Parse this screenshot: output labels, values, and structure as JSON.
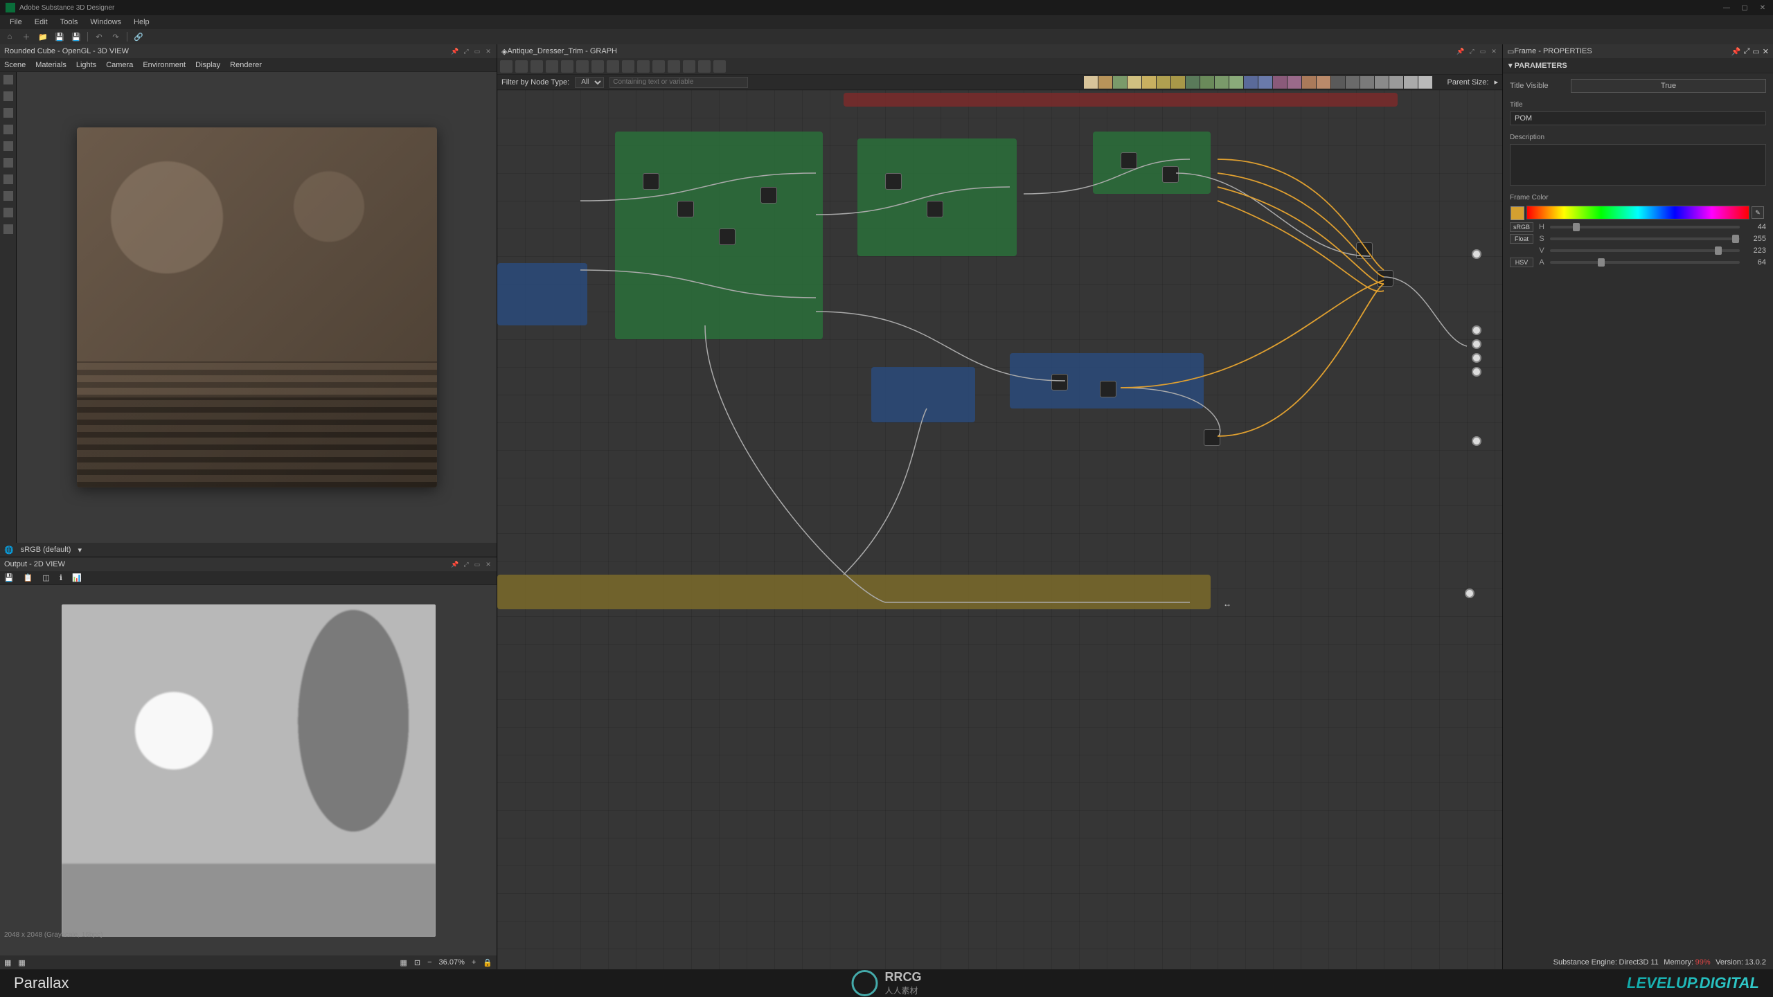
{
  "app": {
    "title": "Adobe Substance 3D Designer"
  },
  "menu": [
    "File",
    "Edit",
    "Tools",
    "Windows",
    "Help"
  ],
  "view3d": {
    "title": "Rounded Cube - OpenGL - 3D VIEW",
    "tabs": [
      "Scene",
      "Materials",
      "Lights",
      "Camera",
      "Environment",
      "Display",
      "Renderer"
    ]
  },
  "colorspace": {
    "label": "sRGB (default)"
  },
  "view2d": {
    "title": "Output - 2D VIEW",
    "status": "2048 x 2048 (Grayscale, 16bpc)",
    "zoom": "36.07%"
  },
  "graph": {
    "title": "Antique_Dresser_Trim - GRAPH",
    "filter_label": "Filter by Node Type:",
    "filter_value": "All",
    "contain_placeholder": "Containing text or variable",
    "parent_label": "Parent Size:"
  },
  "props": {
    "title": "Frame - PROPERTIES",
    "section": "PARAMETERS",
    "title_visible_label": "Title Visible",
    "title_visible_value": "True",
    "title_label": "Title",
    "title_value": "POM",
    "desc_label": "Description",
    "framecolor_label": "Frame Color",
    "hsv": {
      "srgb": "sRGB",
      "float": "Float",
      "hsv": "HSV",
      "H": 44,
      "S": 255,
      "V": 223,
      "A": 64
    }
  },
  "engine": {
    "label_engine": "Substance Engine:",
    "engine": "Direct3D 11",
    "label_mem": "Memory:",
    "mem": "99%",
    "label_ver": "Version:",
    "ver": "13.0.2"
  },
  "footer": {
    "caption": "Parallax",
    "brand_cn": "人人素材",
    "brand_en": "RRCG",
    "levelup": "LEVELUP.DIGITAL"
  },
  "node_palette": [
    "#d8c49a",
    "#b8945a",
    "#7a9a6a",
    "#d0c080",
    "#c8b060",
    "#b0a050",
    "#a89848",
    "#5a7a5a",
    "#6a8a5a",
    "#7a9a6a",
    "#8aaa7a",
    "#5a6a9a",
    "#6a7aaa",
    "#8a5a7a",
    "#9a6a8a",
    "#aa7a5a",
    "#ba8a6a",
    "#5a5a5a",
    "#6a6a6a",
    "#7a7a7a",
    "#8a8a8a",
    "#9a9a9a",
    "#aaaaaa",
    "#bababa"
  ]
}
